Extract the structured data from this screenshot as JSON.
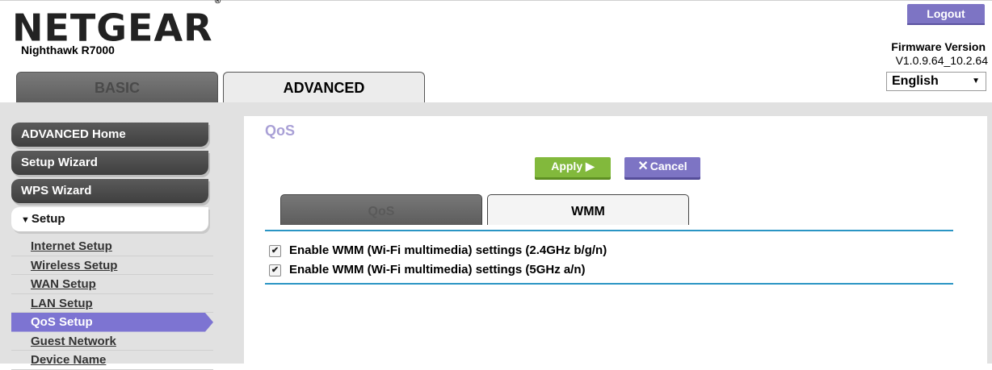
{
  "brand": {
    "logo": "NETGEAR",
    "reg": "®",
    "model": "Nighthawk R7000"
  },
  "header": {
    "logout_label": "Logout",
    "firmware_label": "Firmware Version",
    "firmware_value": "V1.0.9.64_10.2.64",
    "language": "English",
    "language_arrow": "▼"
  },
  "main_tabs": [
    "BASIC",
    "ADVANCED"
  ],
  "active_main_tab": "ADVANCED",
  "sidebar": {
    "buttons": [
      "ADVANCED Home",
      "Setup Wizard",
      "WPS Wizard"
    ],
    "section": {
      "toggle": "▼",
      "label": "Setup"
    },
    "items": [
      "Internet Setup",
      "Wireless Setup",
      "WAN Setup",
      "LAN Setup",
      "QoS Setup",
      "Guest Network",
      "Device Name"
    ],
    "active_item": "QoS Setup"
  },
  "page": {
    "title": "QoS",
    "apply_label": "Apply ▶",
    "cancel_x": "✕",
    "cancel_label": "Cancel",
    "tabs": [
      "QoS",
      "WMM"
    ],
    "active_tab": "WMM",
    "options": [
      {
        "label": "Enable WMM (Wi-Fi multimedia) settings (2.4GHz b/g/n)",
        "checked": true
      },
      {
        "label": "Enable WMM (Wi-Fi multimedia) settings (5GHz a/n)",
        "checked": true
      }
    ],
    "check_glyph": "✔"
  },
  "colors": {
    "accent": "#7d74c4",
    "apply": "#82b93c",
    "rule": "#2a95c4",
    "title": "#a9a0d6"
  }
}
